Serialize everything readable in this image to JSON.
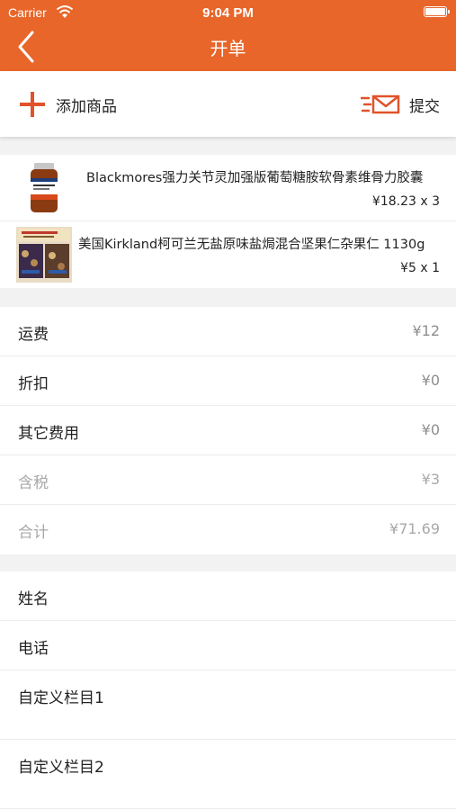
{
  "status_bar": {
    "carrier": "Carrier",
    "time": "9:04 PM"
  },
  "nav": {
    "title": "开单"
  },
  "toolbar": {
    "add_label": "添加商品",
    "submit_label": "提交"
  },
  "products": [
    {
      "name": "Blackmores强力关节灵加强版葡萄糖胺软骨素维骨力胶囊",
      "price_qty": "¥18.23 x 3"
    },
    {
      "name": "美国Kirkland柯可兰无盐原味盐焗混合坚果仁杂果仁 1130g",
      "price_qty": "¥5 x 1"
    }
  ],
  "fees": [
    {
      "label": "运费",
      "value": "¥12"
    },
    {
      "label": "折扣",
      "value": "¥0"
    },
    {
      "label": "其它费用",
      "value": "¥0"
    },
    {
      "label": "含税",
      "value": "¥3"
    },
    {
      "label": "合计",
      "value": "¥71.69"
    }
  ],
  "customer": {
    "name_label": "姓名",
    "phone_label": "电话",
    "custom1_label": "自定义栏目1",
    "custom2_label": "自定义栏目2"
  },
  "colors": {
    "accent": "#e8662a",
    "plus": "#e0522a"
  }
}
